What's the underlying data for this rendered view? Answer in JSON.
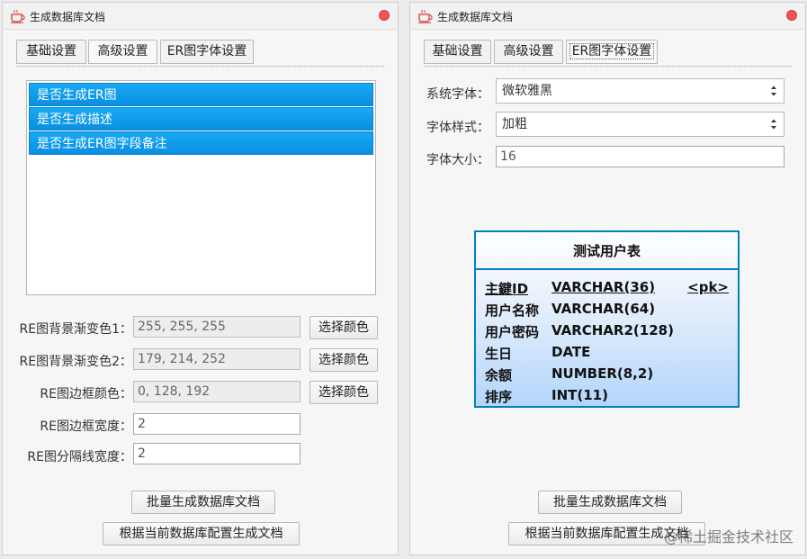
{
  "left_window": {
    "title": "生成数据库文档",
    "tabs": [
      "基础设置",
      "高级设置",
      "ER图字体设置"
    ],
    "active_tab": "高级设置",
    "list_items": [
      "是否生成ER图",
      "是否生成描述",
      "是否生成ER图字段备注"
    ],
    "color_fields": [
      {
        "label": "RE图背景渐变色1：",
        "value": "255, 255, 255",
        "button": "选择颜色"
      },
      {
        "label": "RE图背景渐变色2：",
        "value": "179, 214, 252",
        "button": "选择颜色"
      },
      {
        "label": "RE图边框颜色：",
        "value": "0, 128, 192",
        "button": "选择颜色"
      }
    ],
    "width_fields": [
      {
        "label": "RE图边框宽度：",
        "value": "2"
      },
      {
        "label": "RE图分隔线宽度：",
        "value": "2"
      }
    ],
    "batch_button": "批量生成数据库文档",
    "config_button": "根据当前数据库配置生成文档"
  },
  "right_window": {
    "title": "生成数据库文档",
    "tabs": [
      "基础设置",
      "高级设置",
      "ER图字体设置"
    ],
    "active_tab": "ER图字体设置",
    "font_label": "系统字体：",
    "font_value": "微软雅黑",
    "style_label": "字体样式：",
    "style_value": "加粗",
    "size_label": "字体大小：",
    "size_value": "16",
    "er_preview": {
      "table_name": "测试用户表",
      "border_color": "#0080c0",
      "gradient_colors": [
        "#ffffff",
        "#b3d6fc"
      ],
      "rows": [
        {
          "name": "主鍵ID",
          "type": "VARCHAR(36)",
          "key": "<pk>"
        },
        {
          "name": "用户名称",
          "type": "VARCHAR(64)",
          "key": ""
        },
        {
          "name": "用户密码",
          "type": "VARCHAR2(128)",
          "key": ""
        },
        {
          "name": "生日",
          "type": "DATE",
          "key": ""
        },
        {
          "name": "余额",
          "type": "NUMBER(8,2)",
          "key": ""
        },
        {
          "name": "排序",
          "type": "INT(11)",
          "key": ""
        }
      ]
    },
    "batch_button": "批量生成数据库文档",
    "config_button": "根据当前数据库配置生成文档"
  },
  "watermark": "@稀土掘金技术社区",
  "colors": {
    "accent": "#0a8fe2",
    "close": "#f05454"
  }
}
